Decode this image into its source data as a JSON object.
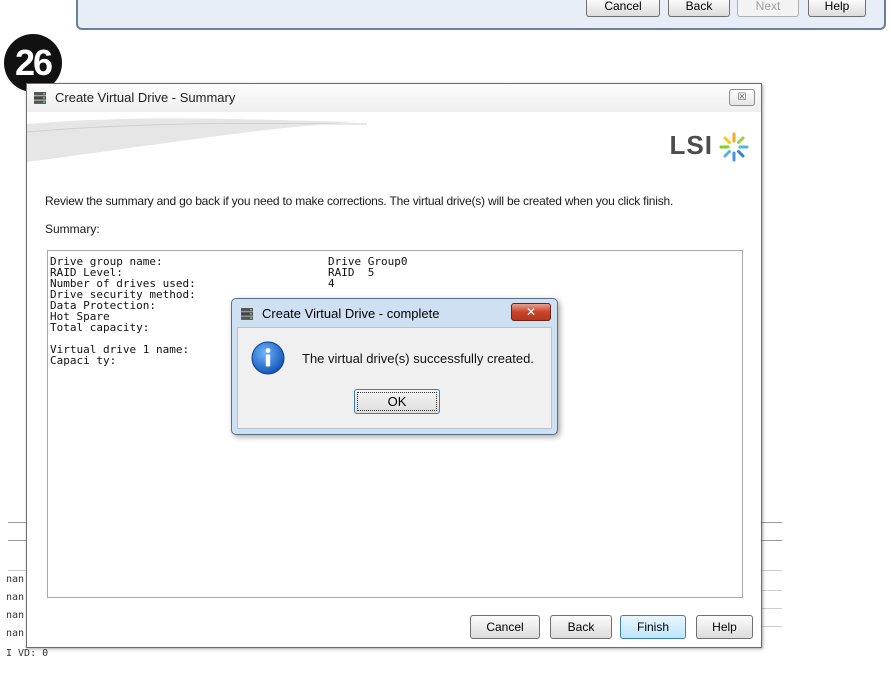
{
  "previous_window": {
    "buttons": [
      {
        "label": "Cancel",
        "enabled": true
      },
      {
        "label": "Back",
        "enabled": true
      },
      {
        "label": "Next",
        "enabled": false
      },
      {
        "label": "Help",
        "enabled": true
      }
    ]
  },
  "step_badge": "26",
  "background_text": {
    "rows": [
      "nan",
      "nan",
      "nan",
      "nan"
    ],
    "footer": "I VD: 0"
  },
  "window": {
    "title": "Create Virtual Drive - Summary",
    "close_glyph": "☒",
    "logo": "LSI",
    "intro": "Review the summary and go back if you need to make corrections. The virtual drive(s) will be created when you click finish.",
    "summary_label": "Summary:",
    "summary_rows": [
      {
        "label": "Drive group name:",
        "value": "Drive Group0"
      },
      {
        "label": "RAID Level:",
        "value": "RAID  5"
      },
      {
        "label": "Number of drives used:",
        "value": "4"
      },
      {
        "label": "Drive security method:",
        "value": ""
      },
      {
        "label": "Data Protection:",
        "value": ""
      },
      {
        "label": "Hot Spare",
        "value": ""
      },
      {
        "label": "Total capacity:",
        "value": ""
      },
      {
        "label": "",
        "value": ""
      },
      {
        "label": "Virtual drive 1 name:",
        "value": ""
      },
      {
        "label": "Capaci ty:",
        "value": ""
      }
    ],
    "buttons": {
      "cancel": "Cancel",
      "back": "Back",
      "finish": "Finish",
      "help": "Help"
    }
  },
  "dialog": {
    "title": "Create Virtual Drive - complete",
    "close_glyph": "✕",
    "message": "The virtual drive(s) successfully created.",
    "ok": "OK",
    "icon": "info-icon"
  },
  "colors": {
    "dialog_frame": "#cfe0f2",
    "primary_button": "#bee6fd",
    "close_red": "#c7452b"
  }
}
